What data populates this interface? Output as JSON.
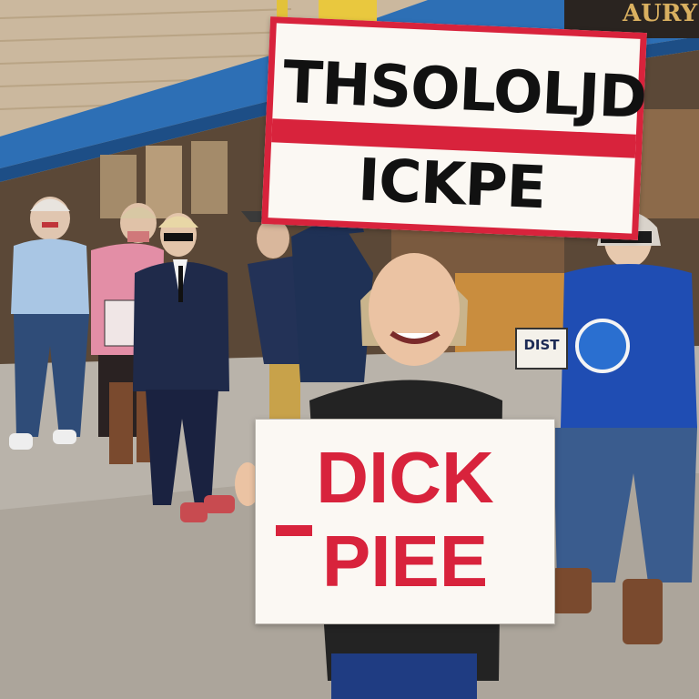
{
  "store_sign": {
    "text": "AURY"
  },
  "top_sign": {
    "line1": "THSOLOLJD",
    "line2": "ICKPE"
  },
  "bottom_sign": {
    "line1": "DICK",
    "line2": "PIEE"
  },
  "small_box_sign": {
    "text": "DIST"
  },
  "colors": {
    "sign_red": "#d8233c",
    "sign_white": "#fbf8f3",
    "awning_blue": "#2d6fb5",
    "sweater_blue": "#1f4db3"
  }
}
